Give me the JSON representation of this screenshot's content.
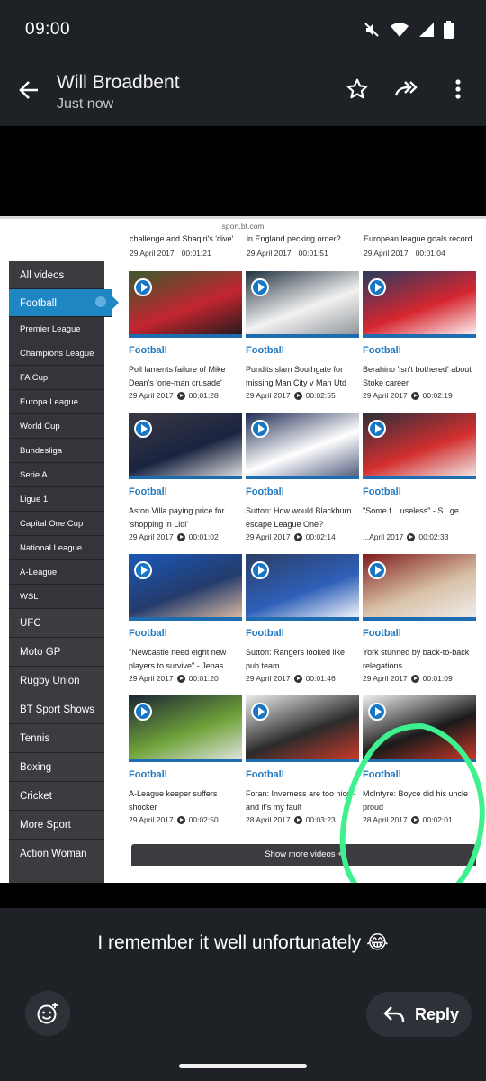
{
  "status_bar": {
    "time": "09:00"
  },
  "header": {
    "sender": "Will Broadbent",
    "timestamp": "Just now"
  },
  "screenshot": {
    "url": "sport.bt.com",
    "top_snippets": [
      {
        "text": "challenge and Shaqiri's 'dive'",
        "date": "29 April 2017",
        "duration": "00:01:21"
      },
      {
        "text": "in England pecking order?",
        "date": "29 April 2017",
        "duration": "00:01:51"
      },
      {
        "text": "European league goals record",
        "date": "29 April 2017",
        "duration": "00:01:04"
      }
    ],
    "sidebar": [
      {
        "label": "All videos",
        "type": "head"
      },
      {
        "label": "Football",
        "type": "active"
      },
      {
        "label": "Premier League",
        "type": "sub"
      },
      {
        "label": "Champions League",
        "type": "sub"
      },
      {
        "label": "FA Cup",
        "type": "sub"
      },
      {
        "label": "Europa League",
        "type": "sub"
      },
      {
        "label": "World Cup",
        "type": "sub"
      },
      {
        "label": "Bundesliga",
        "type": "sub"
      },
      {
        "label": "Serie A",
        "type": "sub"
      },
      {
        "label": "Ligue 1",
        "type": "sub"
      },
      {
        "label": "Capital One Cup",
        "type": "sub"
      },
      {
        "label": "National League",
        "type": "sub"
      },
      {
        "label": "A-League",
        "type": "sub"
      },
      {
        "label": "WSL",
        "type": "sub"
      },
      {
        "label": "UFC",
        "type": "head"
      },
      {
        "label": "Moto GP",
        "type": "head"
      },
      {
        "label": "Rugby Union",
        "type": "head"
      },
      {
        "label": "BT Sport Shows",
        "type": "head"
      },
      {
        "label": "Tennis",
        "type": "head"
      },
      {
        "label": "Boxing",
        "type": "head"
      },
      {
        "label": "Cricket",
        "type": "head"
      },
      {
        "label": "More Sport",
        "type": "head"
      },
      {
        "label": "Action Woman",
        "type": "head"
      }
    ],
    "cards": [
      {
        "category": "Football",
        "headline": "Poll laments failure of Mike Dean's 'one-man crusade'",
        "date": "29 April 2017",
        "duration": "00:01:28"
      },
      {
        "category": "Football",
        "headline": "Pundits slam Southgate for missing Man City v Man Utd",
        "date": "29 April 2017",
        "duration": "00:02:55"
      },
      {
        "category": "Football",
        "headline": "Berahino 'isn't bothered' about Stoke career",
        "date": "29 April 2017",
        "duration": "00:02:19"
      },
      {
        "category": "Football",
        "headline": "Aston Villa paying price for 'shopping in Lidl'",
        "date": "29 April 2017",
        "duration": "00:01:02"
      },
      {
        "category": "Football",
        "headline": "Sutton: How would Blackburn escape League One?",
        "date": "29 April 2017",
        "duration": "00:02:14"
      },
      {
        "category": "Football",
        "headline": "\"Some f... useless\" - S...ge",
        "date": "...April 2017",
        "duration": "00:02:33"
      },
      {
        "category": "Football",
        "headline": "\"Newcastle need eight new players to survive\" - Jenas",
        "date": "29 April 2017",
        "duration": "00:01:20"
      },
      {
        "category": "Football",
        "headline": "Sutton: Rangers looked like pub team",
        "date": "29 April 2017",
        "duration": "00:01:46"
      },
      {
        "category": "Football",
        "headline": "York stunned by back-to-back relegations",
        "date": "29 April 2017",
        "duration": "00:01:09"
      },
      {
        "category": "Football",
        "headline": "A-League keeper suffers shocker",
        "date": "29 April 2017",
        "duration": "00:02:50"
      },
      {
        "category": "Football",
        "headline": "Foran: Inverness are too nice - and it's my fault",
        "date": "28 April 2017",
        "duration": "00:03:23"
      },
      {
        "category": "Football",
        "headline": "McIntyre: Boyce did his uncle proud",
        "date": "28 April 2017",
        "duration": "00:02:01"
      }
    ],
    "more_button": "Show more videos +",
    "highlight_color": "#3ef08e"
  },
  "message": {
    "text": "I remember it well unfortunately 😂"
  },
  "reply": {
    "label": "Reply"
  },
  "icons": [
    "back-arrow-icon",
    "star-icon",
    "forward-icon",
    "more-vert-icon",
    "emoji-add-icon",
    "reply-icon",
    "mute-icon",
    "wifi-icon",
    "signal-icon",
    "battery-icon"
  ]
}
